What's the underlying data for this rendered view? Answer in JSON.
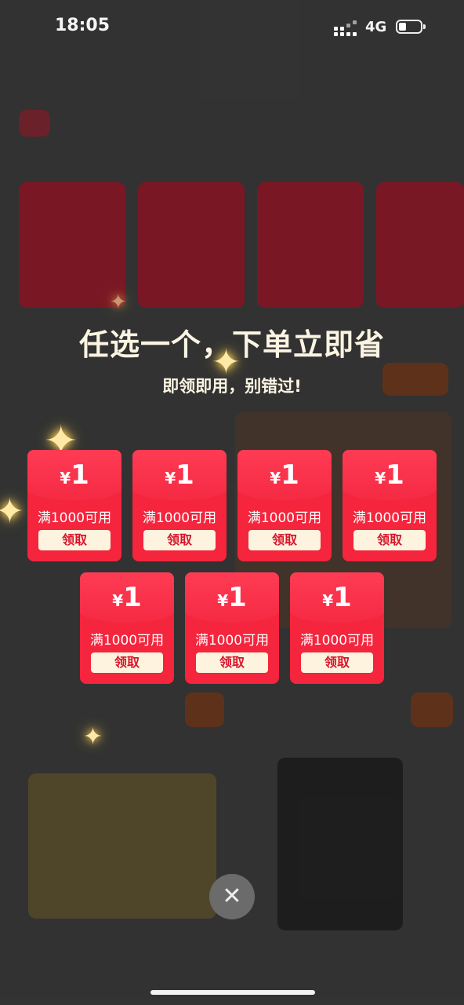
{
  "status_bar": {
    "time": "18:05",
    "network": "4G",
    "battery_level": 0.35
  },
  "popup": {
    "headline": "任选一个，下单立即省",
    "subline": "即领即用，别错过!",
    "coupons": [
      {
        "currency": "¥",
        "amount": "1",
        "condition": "满1000可用",
        "action": "领取"
      },
      {
        "currency": "¥",
        "amount": "1",
        "condition": "满1000可用",
        "action": "领取"
      },
      {
        "currency": "¥",
        "amount": "1",
        "condition": "满1000可用",
        "action": "领取"
      },
      {
        "currency": "¥",
        "amount": "1",
        "condition": "满1000可用",
        "action": "领取"
      },
      {
        "currency": "¥",
        "amount": "1",
        "condition": "满1000可用",
        "action": "领取"
      },
      {
        "currency": "¥",
        "amount": "1",
        "condition": "满1000可用",
        "action": "领取"
      },
      {
        "currency": "¥",
        "amount": "1",
        "condition": "满1000可用",
        "action": "领取"
      }
    ],
    "close_icon": "close-icon"
  },
  "colors": {
    "coupon_red": "#f4253c",
    "claim_button_bg": "#fdf3de",
    "headline_text": "#fbf4e2"
  }
}
